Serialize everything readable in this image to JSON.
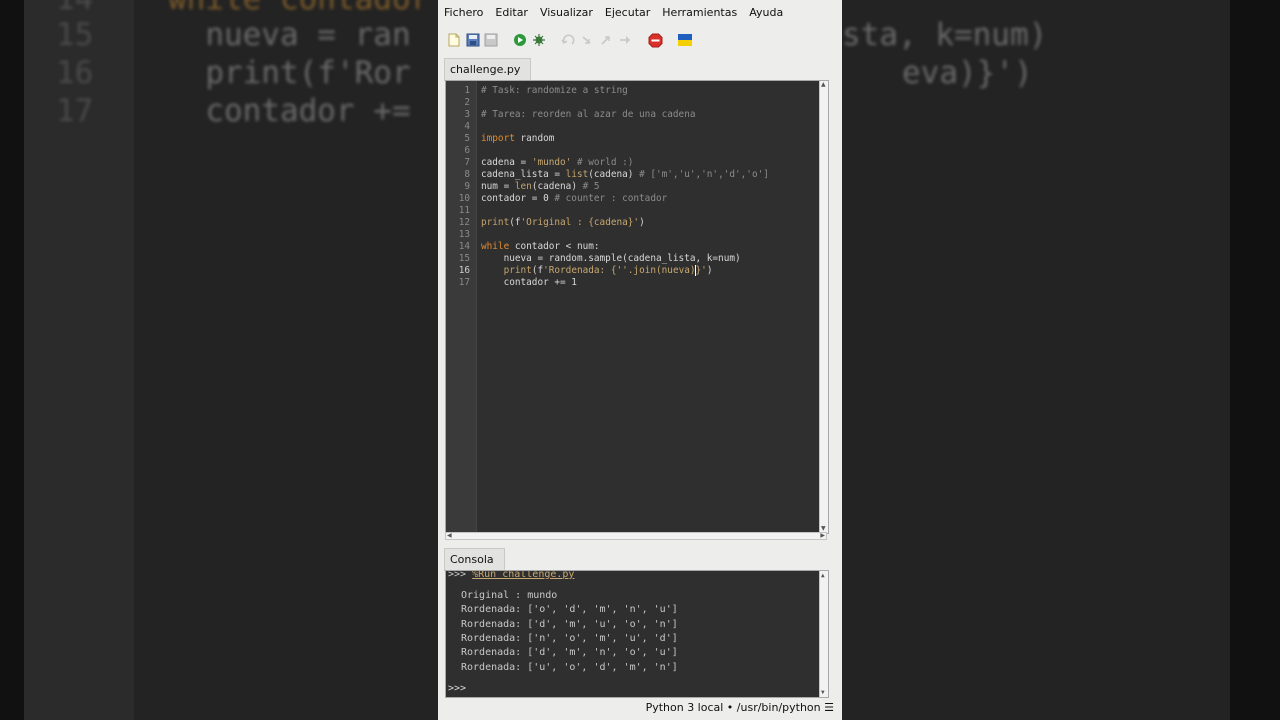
{
  "background": {
    "lines": [
      {
        "num": "14",
        "code": "while contador"
      },
      {
        "num": "15",
        "code": "nueva = ran",
        "right": "sta, k=num)"
      },
      {
        "num": "16",
        "code": "print(f'Ror",
        "right": "eva)}')"
      },
      {
        "num": "17",
        "code": "contador +="
      }
    ]
  },
  "menubar": {
    "items": [
      "Fichero",
      "Editar",
      "Visualizar",
      "Ejecutar",
      "Herramientas",
      "Ayuda"
    ]
  },
  "toolbar": {
    "icons": [
      "new-file-icon",
      "save-icon",
      "save-as-icon",
      "run-icon",
      "debug-icon",
      "undo-icon",
      "redo-icon",
      "step-into-icon",
      "step-over-icon",
      "stop-icon",
      "ukraine-flag-icon"
    ]
  },
  "editor": {
    "tab_label": "challenge.py",
    "current_line": 16,
    "lines": [
      {
        "n": "1",
        "text": "# Task: randomize a string"
      },
      {
        "n": "2",
        "text": ""
      },
      {
        "n": "3",
        "text": "# Tarea: reorden al azar de una cadena"
      },
      {
        "n": "4",
        "text": ""
      },
      {
        "n": "5",
        "text": "import random"
      },
      {
        "n": "6",
        "text": ""
      },
      {
        "n": "7",
        "text": "cadena = 'mundo' # world :)"
      },
      {
        "n": "8",
        "text": "cadena_lista = list(cadena) # ['m','u','n','d','o']"
      },
      {
        "n": "9",
        "text": "num = len(cadena) # 5"
      },
      {
        "n": "10",
        "text": "contador = 0 # counter : contador"
      },
      {
        "n": "11",
        "text": ""
      },
      {
        "n": "12",
        "text": "print(f'Original : {cadena}')"
      },
      {
        "n": "13",
        "text": ""
      },
      {
        "n": "14",
        "text": "while contador < num:"
      },
      {
        "n": "15",
        "text": "    nueva = random.sample(cadena_lista, k=num)"
      },
      {
        "n": "16",
        "text": "    print(f'Rordenada: {''.join(nueva)}')"
      },
      {
        "n": "17",
        "text": "    contador += 1"
      }
    ]
  },
  "console": {
    "tab_label": "Consola",
    "command_prompt": ">>> ",
    "command": "%Run challenge.py",
    "output": [
      "Original : mundo",
      "Rordenada: ['o', 'd', 'm', 'n', 'u']",
      "Rordenada: ['d', 'm', 'u', 'o', 'n']",
      "Rordenada: ['n', 'o', 'm', 'u', 'd']",
      "Rordenada: ['d', 'm', 'n', 'o', 'u']",
      "Rordenada: ['u', 'o', 'd', 'm', 'n']"
    ],
    "prompt": ">>>"
  },
  "statusbar": {
    "interpreter": "Python 3 local • /usr/bin/python ☰"
  }
}
